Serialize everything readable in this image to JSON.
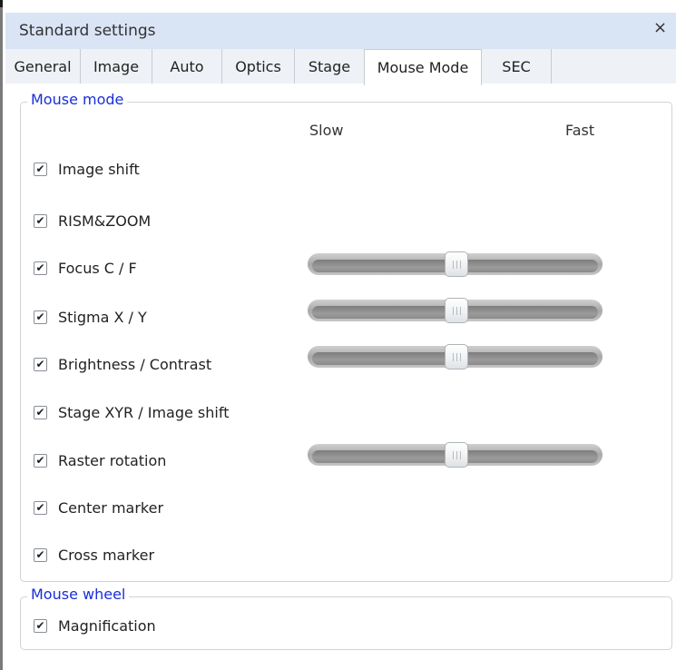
{
  "window": {
    "title": "Standard settings",
    "close_icon": "×"
  },
  "tabs": [
    {
      "label": "General",
      "active": false
    },
    {
      "label": "Image",
      "active": false
    },
    {
      "label": "Auto",
      "active": false
    },
    {
      "label": "Optics",
      "active": false
    },
    {
      "label": "Stage",
      "active": false
    },
    {
      "label": "Mouse Mode",
      "active": true
    },
    {
      "label": "SEC",
      "active": false
    }
  ],
  "mouse_mode": {
    "legend": "Mouse mode",
    "slow_label": "Slow",
    "fast_label": "Fast",
    "items": [
      {
        "label": "Image shift",
        "checked": true
      },
      {
        "label": "RISM&ZOOM",
        "checked": true
      },
      {
        "label": "Focus C / F",
        "checked": true,
        "slider": 0.5
      },
      {
        "label": "Stigma X / Y",
        "checked": true,
        "slider": 0.5
      },
      {
        "label": "Brightness / Contrast",
        "checked": true,
        "slider": 0.5
      },
      {
        "label": "Stage XYR / Image shift",
        "checked": true
      },
      {
        "label": "Raster rotation",
        "checked": true,
        "slider": 0.5
      },
      {
        "label": "Center marker",
        "checked": true
      },
      {
        "label": "Cross marker",
        "checked": true
      }
    ]
  },
  "mouse_wheel": {
    "legend": "Mouse wheel",
    "items": [
      {
        "label": "Magnification",
        "checked": true
      }
    ]
  },
  "check_glyph": "✔"
}
